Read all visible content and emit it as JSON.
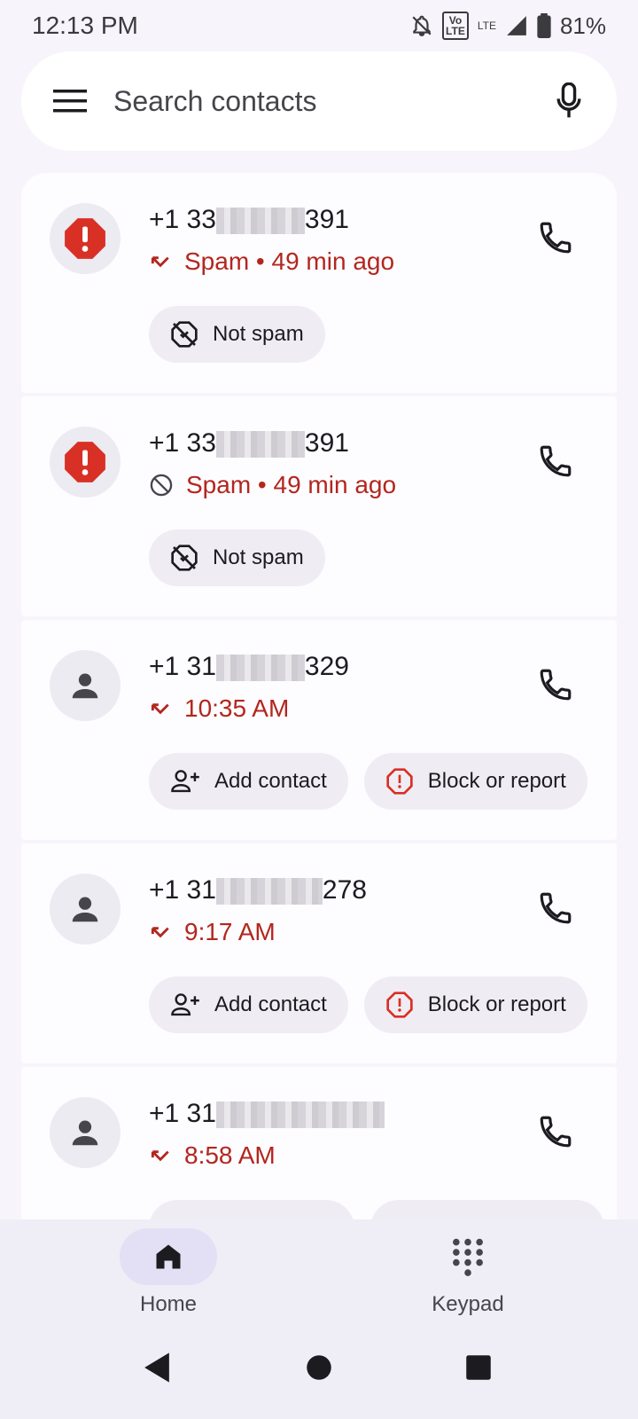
{
  "status_bar": {
    "time": "12:13 PM",
    "volte": "Vo\nLTE",
    "lte": "LTE",
    "battery": "81%"
  },
  "search": {
    "placeholder": "Search contacts"
  },
  "calls": [
    {
      "number_prefix": "+1 33",
      "number_suffix": "391",
      "status": "Spam • 49 min ago",
      "type": "spam",
      "direction": "missed",
      "actions": [
        "Not spam"
      ]
    },
    {
      "number_prefix": "+1 33",
      "number_suffix": "391",
      "status": "Spam • 49 min ago",
      "type": "spam",
      "direction": "blocked",
      "actions": [
        "Not spam"
      ]
    },
    {
      "number_prefix": "+1 31",
      "number_suffix": "329",
      "status": "10:35 AM",
      "type": "unknown",
      "direction": "missed",
      "actions": [
        "Add contact",
        "Block or report"
      ]
    },
    {
      "number_prefix": "+1 31",
      "number_suffix": "278",
      "status": "9:17 AM",
      "type": "unknown",
      "direction": "missed",
      "actions": [
        "Add contact",
        "Block or report"
      ]
    },
    {
      "number_prefix": "+1 31",
      "number_suffix": "",
      "status": "8:58 AM",
      "type": "unknown",
      "direction": "missed",
      "actions": []
    }
  ],
  "bottom_nav": {
    "home": "Home",
    "keypad": "Keypad"
  },
  "colors": {
    "spam_red": "#d93025",
    "missed_red": "#b3261e",
    "accent_pill": "#e3e0f5"
  },
  "icons": [
    "menu-icon",
    "mic-icon",
    "spam-icon",
    "person-icon",
    "phone-icon",
    "missed-call-icon",
    "blocked-icon",
    "not-spam-icon",
    "add-contact-icon",
    "block-report-icon",
    "home-icon",
    "keypad-icon"
  ]
}
